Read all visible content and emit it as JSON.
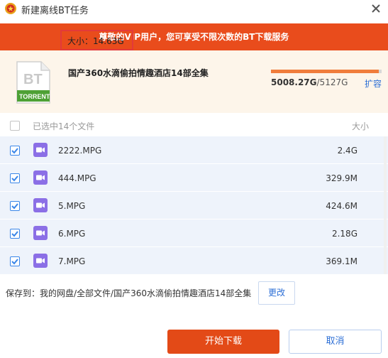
{
  "window": {
    "title": "新建离线BT任务"
  },
  "vip_banner": {
    "text": "尊敬的VIP用户，您可享受不限次数的BT下载服务"
  },
  "torrent": {
    "icon_text_top": "BT",
    "icon_text_bottom": "TORRENT",
    "name": "国产360水滴偷拍情趣酒店14部全集",
    "size_label": "大小：14.63G"
  },
  "quota": {
    "used": "5008.27G",
    "total": "/5127G",
    "used_fraction": 0.9768,
    "expand_label": "扩容"
  },
  "file_list": {
    "header_label": "已选中14个文件",
    "size_header": "大小",
    "files": [
      {
        "name": "2222.MPG",
        "size": "2.4G"
      },
      {
        "name": "444.MPG",
        "size": "329.9M"
      },
      {
        "name": "5.MPG",
        "size": "424.6M"
      },
      {
        "name": "6.MPG",
        "size": "2.18G"
      },
      {
        "name": "7.MPG",
        "size": "369.1M"
      }
    ]
  },
  "save_path": {
    "text": "保存到：我的网盘/全部文件/国产360水滴偷拍情趣酒店14部全集",
    "change_label": "更改"
  },
  "actions": {
    "start_label": "开始下载",
    "cancel_label": "取消"
  },
  "colors": {
    "accent": "#e34a17",
    "link": "#2d6fd6",
    "row_bg": "#eef3fb",
    "video_icon": "#8b6fe6"
  }
}
